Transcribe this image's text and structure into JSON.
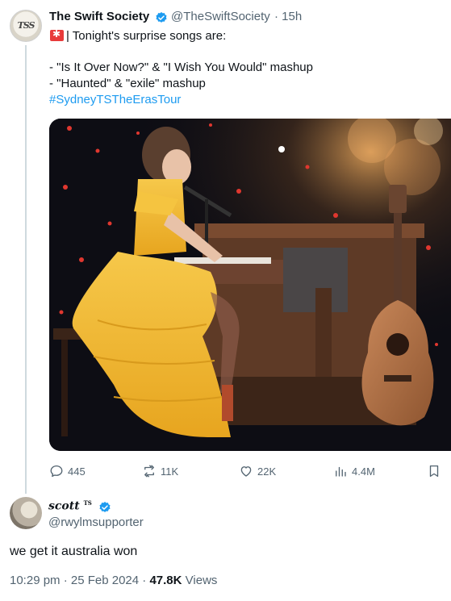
{
  "tweet": {
    "author_name": "The Swift Society",
    "author_handle": "@TheSwiftSociety",
    "time": "· 15h",
    "avatar_text": "TSS",
    "line1": "| Tonight's surprise songs are:",
    "line2": "- \"Is It Over Now?\" & \"I Wish You Would\" mashup",
    "line3": "- \"Haunted\" & \"exile\" mashup",
    "hashtag": "#SydneyTSTheErasTour",
    "stats": {
      "replies": "445",
      "retweets": "11K",
      "likes": "22K",
      "views": "4.4M"
    }
  },
  "reply": {
    "author_name": "scott",
    "author_sup": "TS",
    "author_handle": "@rwylmsupporter",
    "text": "we get it australia won",
    "time": "10:29 pm · 25 Feb 2024 ·",
    "views_count": "47.8K",
    "views_label": "Views"
  },
  "colors": {
    "accent": "#1d9bf0",
    "muted": "#536471",
    "dress": "#f2b830",
    "flag": "#e83a3a"
  }
}
